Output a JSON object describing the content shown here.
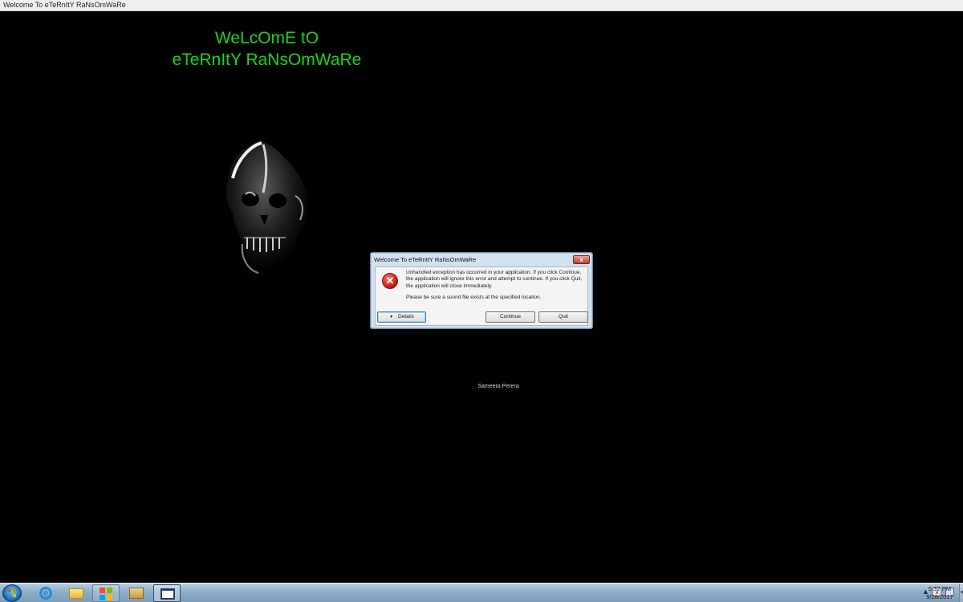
{
  "window": {
    "title": "Welcome To eTeRnItY RaNsOmWaRe"
  },
  "main": {
    "headline_line1": "WeLcOmE tO",
    "headline_line2": "eTeRnItY RaNsOmWaRe",
    "credit": "Sameera Perera",
    "headline_color": "#19d719",
    "background_color": "#000000"
  },
  "dialog": {
    "title": "Welcome To eTeRnItY RaNsOmWaRe",
    "close_label": "x",
    "icon": "error-icon",
    "message": "Unhandled exception has occurred in your application. If you click Continue, the application will ignore this error and attempt to continue. If you click Quit, the application will close immediately.",
    "detail": "Please be sure a sound file exists at the specified location.",
    "details_label": "Details",
    "continue_label": "Continue",
    "quit_label": "Quit"
  },
  "taskbar": {
    "pinned": [
      {
        "name": "internet-explorer-icon"
      },
      {
        "name": "windows-explorer-icon"
      },
      {
        "name": "windows-media-player-icon"
      },
      {
        "name": "folder-icon"
      },
      {
        "name": "application-window-icon"
      }
    ],
    "clock": {
      "time": "5:32 PM",
      "date": "9/28/2017"
    }
  }
}
